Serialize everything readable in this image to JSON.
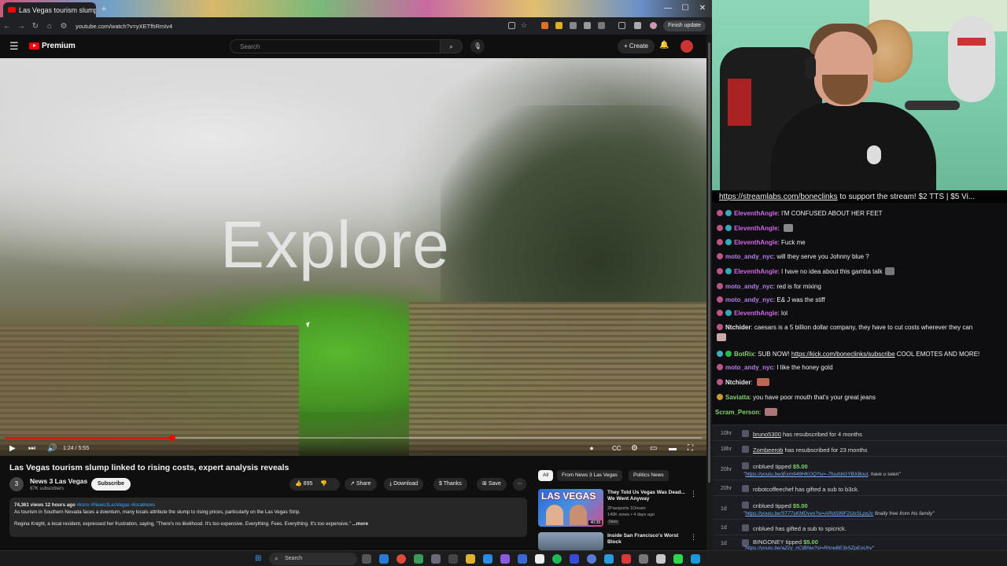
{
  "browser": {
    "tab_title": "Las Vegas tourism slump linked t",
    "url": "youtube.com/watch?v=yXETfhRmIv4",
    "finish_update": "Finish update"
  },
  "youtube": {
    "brand": "Premium",
    "search_placeholder": "Search",
    "create_label": "Create",
    "video": {
      "overlay_text": "Explore",
      "time": "1:24 / 5:55",
      "progress": 0.24
    },
    "title": "Las Vegas tourism slump linked to rising costs, expert analysis reveals",
    "channel": {
      "name": "News 3 Las Vegas",
      "subscribers": "87K subscribers",
      "avatar_text": "3"
    },
    "subscribe_label": "Subscribe",
    "actions": {
      "likes": "895",
      "share": "Share",
      "download": "Download",
      "thanks": "Thanks",
      "save": "Save"
    },
    "description": {
      "meta": "74,361 views  12 hours ago",
      "tags": "#ksnv #News3LasVegas #localnews",
      "line1": "As tourism in Southern Nevada faces a downturn, many locals attribute the slump to rising prices, particularly on the Las Vegas Strip.",
      "line2": "Regina Knight, a local resident, expressed her frustration, saying, \"There's no likelihood. It's too expensive. Everything. Fees. Everything. It's too expensive.\"",
      "more": "...more"
    },
    "chips": [
      "All",
      "From News 3 Las Vegas",
      "Politics News"
    ],
    "recommendations": [
      {
        "title": "They Told Us Vegas Was Dead... We Went Anyway",
        "channel": "2Passports 1Dream",
        "stats": "140K views • 4 days ago",
        "badge": "New",
        "thumb_text": "LAS VEGAS",
        "duration": "40:38"
      },
      {
        "title": "Inside San Francisco's Worst Block",
        "channel": "",
        "stats": "",
        "badge": "",
        "thumb_text": "",
        "duration": ""
      }
    ]
  },
  "stream": {
    "ticker_link": "https://streamlabs.com/boneclinks",
    "ticker_rest": " to support the stream! $2 TTS | $5 Vi..."
  },
  "chat": [
    {
      "user": "EleventhAngle",
      "color": "#d266e6",
      "text": "I'M CONFUSED ABOUT HER FEET",
      "emote": false
    },
    {
      "user": "EleventhAngle",
      "color": "#d266e6",
      "text": "",
      "emote": true
    },
    {
      "user": "EleventhAngle",
      "color": "#d266e6",
      "text": "Fuck me",
      "emote": false
    },
    {
      "user": "moto_andy_nyc",
      "color": "#b47fe8",
      "text": "will they serve you Johnny blue ?",
      "emote": false
    },
    {
      "user": "EleventhAngle",
      "color": "#d266e6",
      "text": "I have no idea about this gamba talk",
      "emote": true
    },
    {
      "user": "moto_andy_nyc",
      "color": "#b47fe8",
      "text": "red is for mixing",
      "emote": false
    },
    {
      "user": "moto_andy_nyc",
      "color": "#b47fe8",
      "text": "E& J was the stiff",
      "emote": false
    },
    {
      "user": "EleventhAngle",
      "color": "#d266e6",
      "text": "lol",
      "emote": false
    },
    {
      "user": "Ntchider",
      "color": "#e8e8e8",
      "text": "caesars is a 5 billion dollar company, they have to cut costs wherever they can",
      "emote": false
    },
    {
      "user": "BotRix",
      "color": "#7fd26a",
      "text": "SUB NOW!",
      "link": "https://kick.com/boneclinks/subscribe",
      "tail": "COOL EMOTES AND MORE!",
      "emote": false
    },
    {
      "user": "moto_andy_nyc",
      "color": "#b47fe8",
      "text": "I like the honey gold",
      "emote": false
    },
    {
      "user": "Ntchider",
      "color": "#e8e8e8",
      "text": "",
      "emote": true
    },
    {
      "user": "Saviatta",
      "color": "#7fd26a",
      "text": "you have poor mouth that's your great jeans",
      "emote": false
    },
    {
      "user": "Scram_Person",
      "color": "#7fd26a",
      "text": "",
      "emote": true
    }
  ],
  "events": [
    {
      "time": "10hr",
      "name": "bruno5300",
      "action": "has resubscribed for 4 months",
      "amount": "",
      "message": "",
      "msg_tail": ""
    },
    {
      "time": "18hr",
      "name": "Zombeerob",
      "action": "has resubscribed for 23 months",
      "amount": "",
      "message": "",
      "msg_tail": ""
    },
    {
      "time": "20hr",
      "name": "cnblued",
      "action": "tipped",
      "amount": "$5.00",
      "message": "https://youtu.be/jExm949HKOQ?si=-7fuuhbGYBXBoul",
      "msg_tail": ", have u seen"
    },
    {
      "time": "20hr",
      "name": "robotcoffeechef",
      "action": "has gifted a sub to b3ck.",
      "amount": "",
      "message": "",
      "msg_tail": ""
    },
    {
      "time": "1d",
      "name": "cnblued",
      "action": "tipped",
      "amount": "$5.00",
      "message": "https://youtu.be/5T77sKMDvvo?si=ARdS99F2UoSLpx2c",
      "msg_tail": " finally free from his family"
    },
    {
      "time": "1d",
      "name": "cnblued",
      "action": "has gifted a sub to spicrick.",
      "amount": "",
      "message": "",
      "msg_tail": ""
    },
    {
      "time": "1d",
      "name": "BINGONEY",
      "action": "tipped",
      "amount": "$5.00",
      "message": "https://youtu.be/aZzy_nCiBNw?si=RhneBE3x5ZpEoUhv",
      "msg_tail": ""
    }
  ],
  "taskbar": {
    "search_label": "Search"
  }
}
